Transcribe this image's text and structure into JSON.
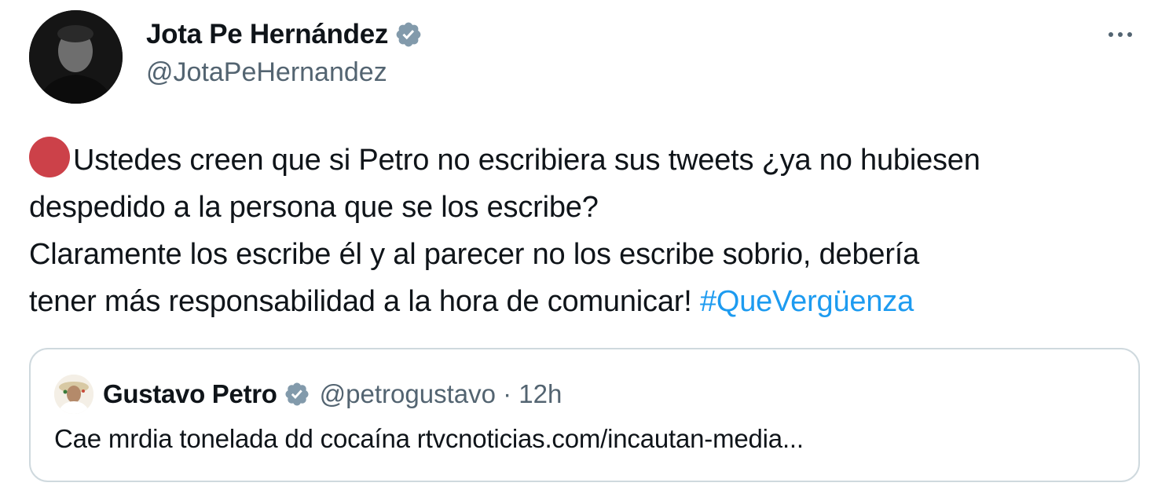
{
  "author": {
    "display_name": "Jota Pe Hernández",
    "handle": "@JotaPeHernandez",
    "verified": true
  },
  "tweet": {
    "line1": "Ustedes creen que si Petro no escribiera sus tweets ¿ya no hubiesen",
    "line2": "despedido a la persona que se los escribe?",
    "line3": "Claramente los escribe él y al parecer no los escribe sobrio, debería",
    "line4_text": "tener más responsabilidad a la hora de comunicar! ",
    "hashtag": "#QueVergüenza"
  },
  "quoted_tweet": {
    "display_name": "Gustavo Petro",
    "handle": "@petrogustavo",
    "separator": "·",
    "time": "12h",
    "meta": "@petrogustavo · 12h",
    "text": "Cae mrdia tonelada dd cocaína rtvcnoticias.com/incautan-media..."
  },
  "colors": {
    "text_primary": "#0f1419",
    "text_secondary": "#536471",
    "hashtag": "#1d9bf0",
    "verified_badge": "#829aab",
    "red_circle_emoji": "#cc4149",
    "border": "#cfd9de"
  },
  "icons": {
    "verified": "verified-badge-icon",
    "more": "more-options-icon",
    "emoji": "red-circle-emoji"
  }
}
